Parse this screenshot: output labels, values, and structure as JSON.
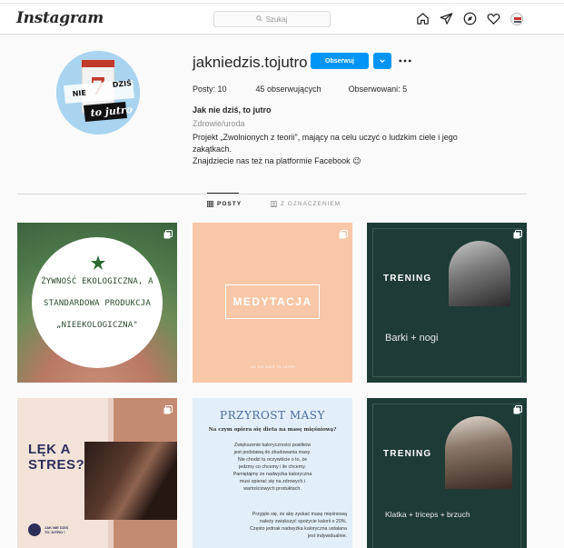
{
  "header": {
    "logo": "Instagram",
    "search_placeholder": "Szukaj",
    "nav_icons": [
      "home-icon",
      "direct-icon",
      "explore-icon",
      "heart-icon",
      "profile-avatar"
    ]
  },
  "profile": {
    "username": "jakniedzis.tojutro",
    "follow_label": "Obserwuj",
    "stats": {
      "posts": "Posty: 10",
      "followers": "45 obserwujących",
      "following": "Obserwowani: 5"
    },
    "full_name": "Jak nie dziś, to jutro",
    "category": "Zdrowie/uroda",
    "bio_lines": [
      "Projekt „Zwolnionych z teorii\", mający na celu uczyć o ludzkim ciele i jego",
      "zakątkach.",
      "Znajdziecie nas też na platformie Facebook 😉"
    ],
    "avatar_text": "NIE DZIŚ 7 TO jutro"
  },
  "tabs": {
    "posts": "POSTY",
    "tagged": "Z OZNACZENIEM"
  },
  "posts": [
    {
      "lines": [
        "ŻYWNOŚĆ EKOLOGICZNA, A",
        "STANDARDOWA PRODUKCJA",
        "„NIEEKOLOGICZNA\""
      ]
    },
    {
      "title": "MEDYTACJA",
      "footer": "JAK NIE DZIŚ TO JUTRO"
    },
    {
      "title": "TRENING",
      "subtitle": "Barki + nogi"
    },
    {
      "title_l1": "LĘK A",
      "title_l2": "STRES?",
      "brand_l1": "JAK NIE DZIŚ",
      "brand_l2": "TO JUTRO !"
    },
    {
      "title": "PRZYROST MASY",
      "question": "Na czym opiera się dieta na masę mięśniową?",
      "para1": [
        "Zwiększenie kaloryczności posiłków",
        "jest podstawą do zbudowania masy.",
        "Nie chodzi tu oczywiście o to, że",
        "jedzmy co chcemy i ile chcemy.",
        "Pamiętajmy że nadwyżka kaloryczna",
        "musi opierać się na zdrowych i",
        "wartościowych produktach."
      ],
      "para2": [
        "Przyjęło się, że aby zyskać masę mięśniową",
        "należy zwiększyć spożycie kalorii o 20%.",
        "Często jednak nadwyżka kaloryczna ustalana",
        "jest indywidualnie."
      ]
    },
    {
      "title": "TRENING",
      "subtitle": "Klatka + triceps + brzuch"
    }
  ],
  "colors": {
    "accent": "#0095f6",
    "post3_bg": "#1f3b36",
    "post2_bg": "#f8c7a8",
    "post5_bg": "#e2eef9"
  }
}
